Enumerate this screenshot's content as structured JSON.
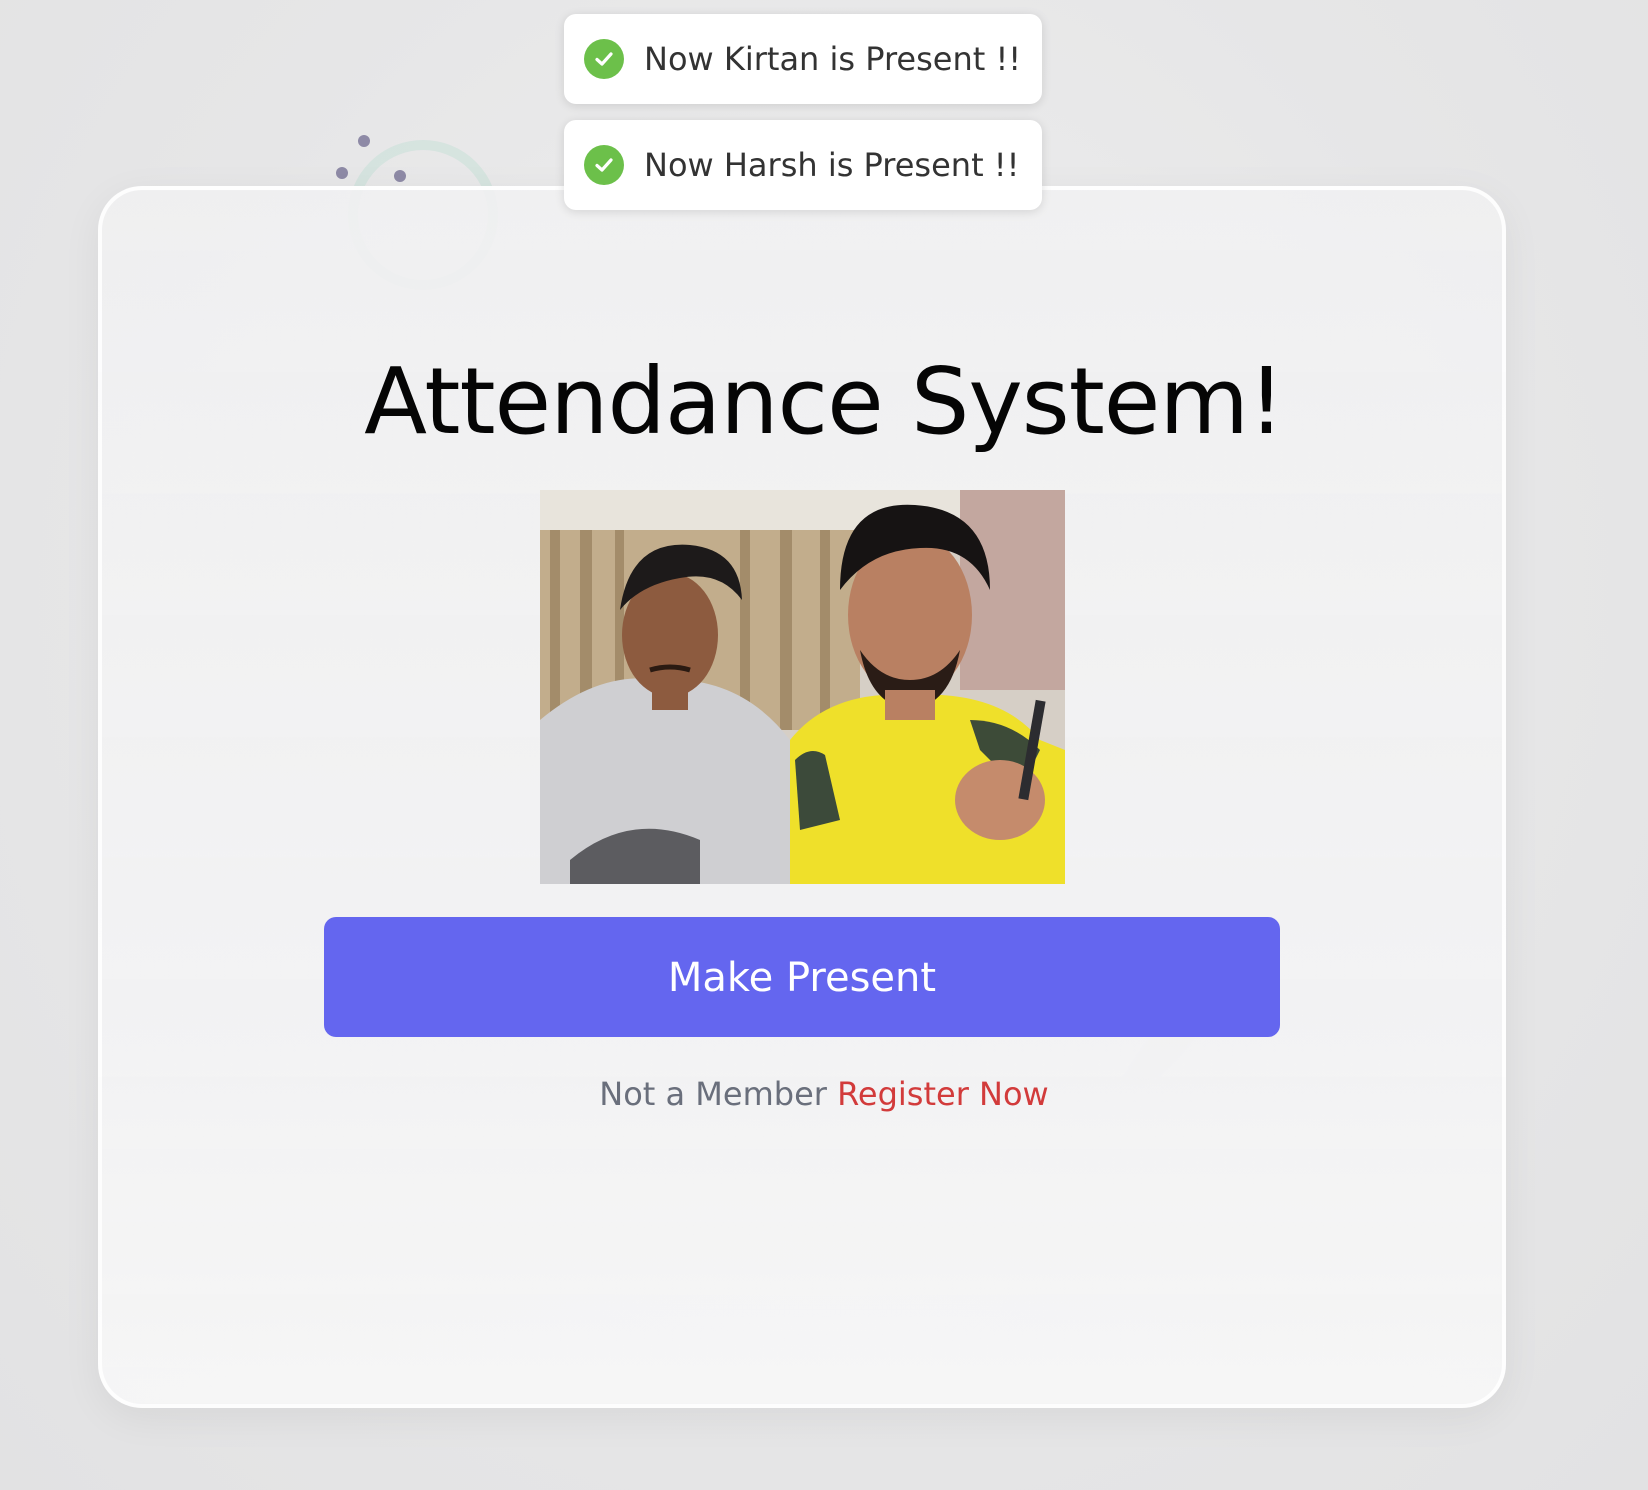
{
  "toasts": [
    {
      "message": "Now Kirtan is Present !!",
      "icon": "check-circle-icon",
      "color": "#6cc04a"
    },
    {
      "message": "Now Harsh is Present !!",
      "icon": "check-circle-icon",
      "color": "#6cc04a"
    }
  ],
  "main": {
    "title": "Attendance System!",
    "camera_feed": {
      "description_icon": "webcam-feed"
    },
    "primary_button": {
      "label": "Make Present",
      "color": "#6466ef"
    },
    "register": {
      "prompt": "Not a Member",
      "link_label": "Register Now",
      "link_color": "#d23b3b"
    }
  }
}
